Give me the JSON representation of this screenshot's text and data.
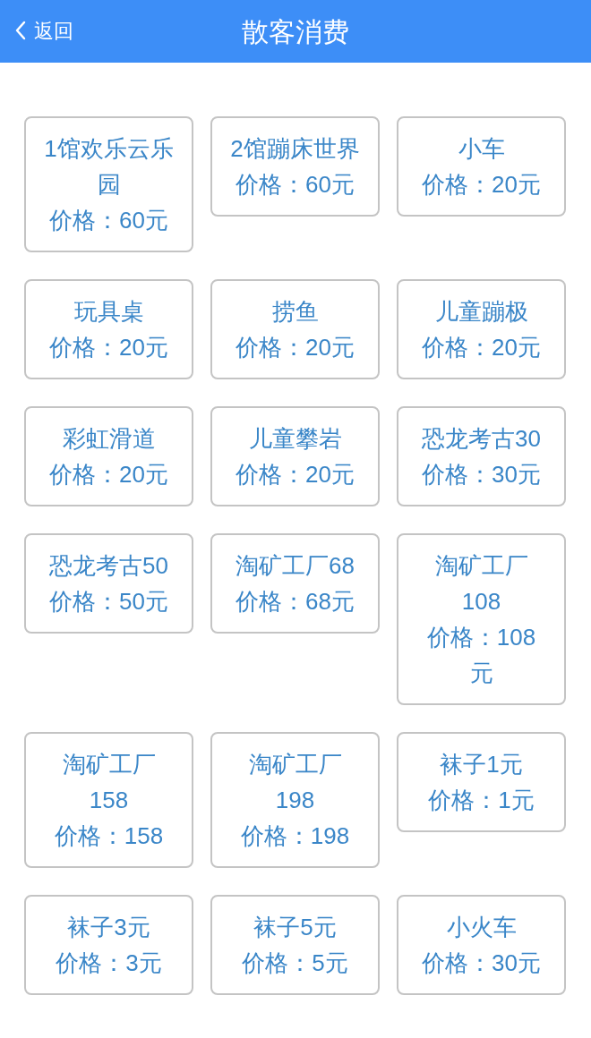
{
  "header": {
    "back": "返回",
    "title": "散客消费"
  },
  "items": [
    {
      "name": "1馆欢乐云乐园",
      "price": "价格：60元"
    },
    {
      "name": "2馆蹦床世界",
      "price": "价格：60元"
    },
    {
      "name": "小车",
      "price": "价格：20元"
    },
    {
      "name": "玩具桌",
      "price": "价格：20元"
    },
    {
      "name": "捞鱼",
      "price": "价格：20元"
    },
    {
      "name": "儿童蹦极",
      "price": "价格：20元"
    },
    {
      "name": "彩虹滑道",
      "price": "价格：20元"
    },
    {
      "name": "儿童攀岩",
      "price": "价格：20元"
    },
    {
      "name": "恐龙考古30",
      "price": "价格：30元"
    },
    {
      "name": "恐龙考古50",
      "price": "价格：50元"
    },
    {
      "name": "淘矿工厂68",
      "price": "价格：68元"
    },
    {
      "name": "淘矿工厂108",
      "price": "价格：108元"
    },
    {
      "name": "淘矿工厂158",
      "price": "价格：158"
    },
    {
      "name": "淘矿工厂198",
      "price": "价格：198"
    },
    {
      "name": "袜子1元",
      "price": "价格：1元"
    },
    {
      "name": "袜子3元",
      "price": "价格：3元"
    },
    {
      "name": "袜子5元",
      "price": "价格：5元"
    },
    {
      "name": "小火车",
      "price": "价格：30元"
    }
  ]
}
